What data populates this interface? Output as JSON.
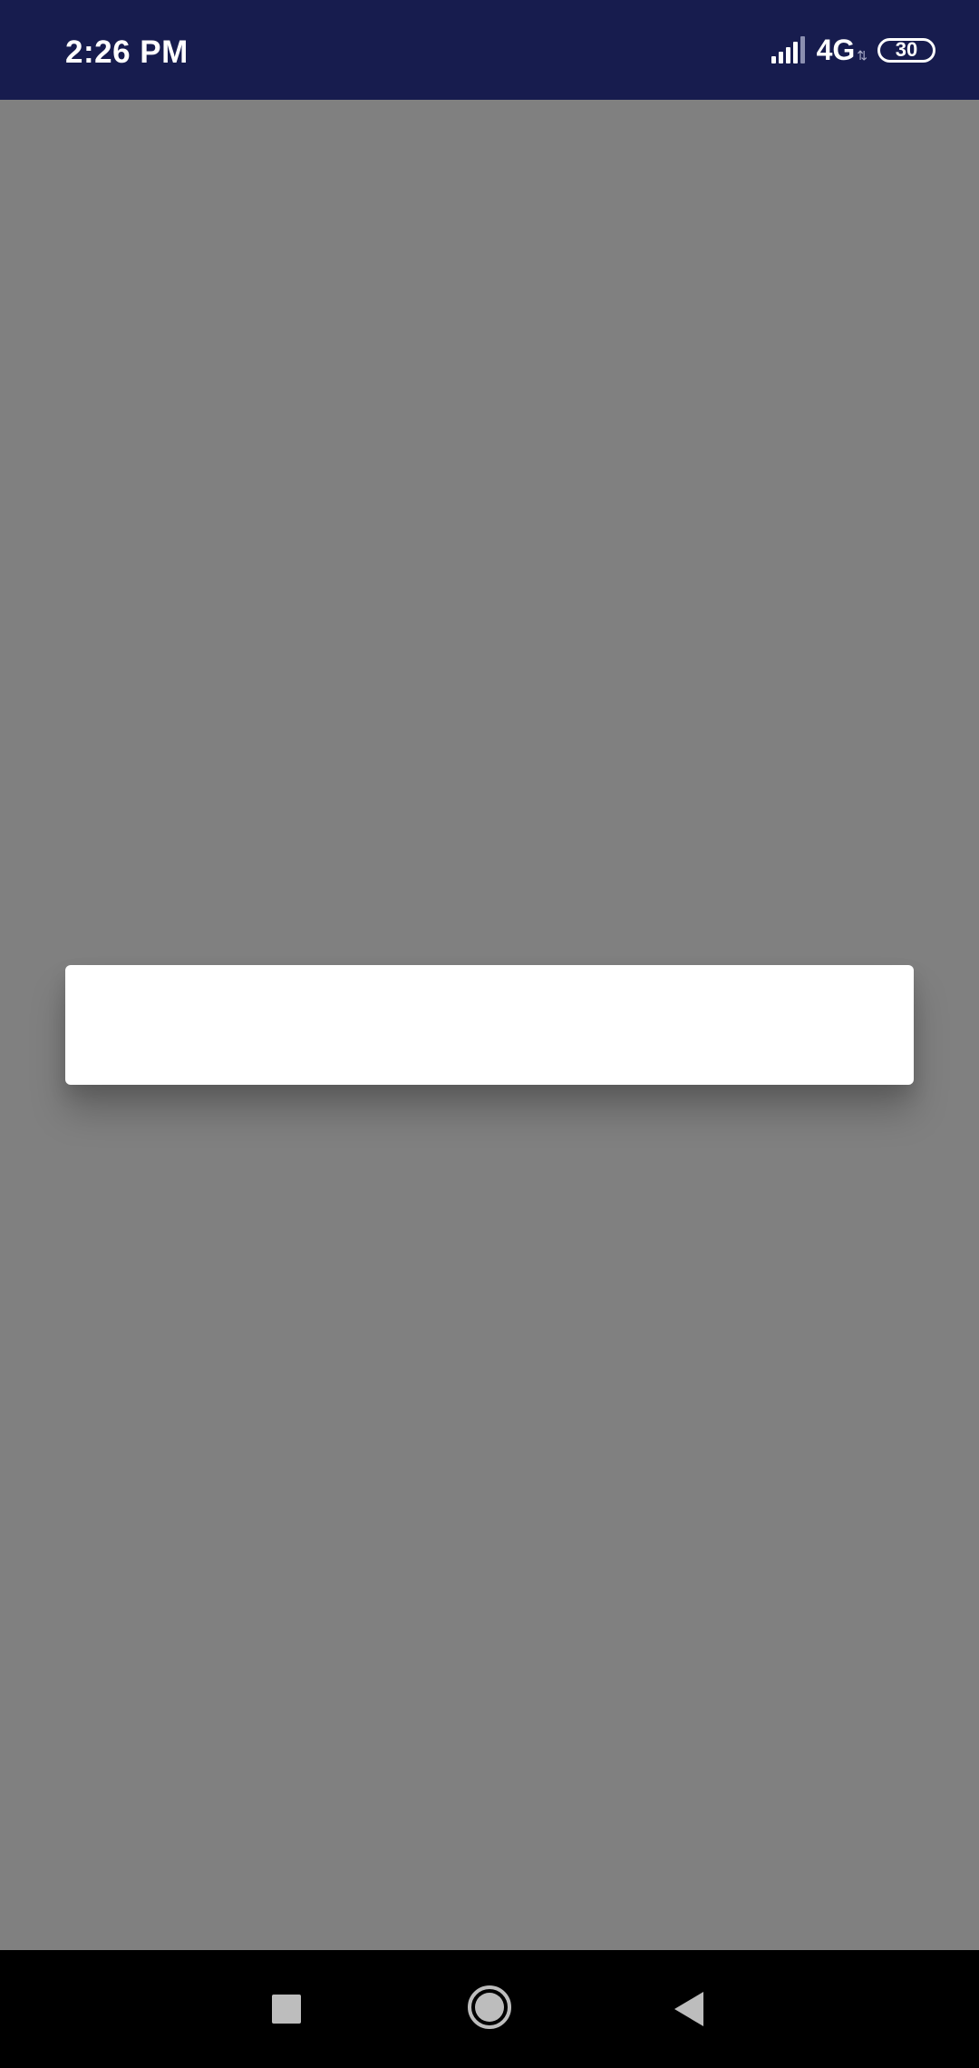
{
  "status_bar": {
    "time": "2:26 PM",
    "network": "4G",
    "data_activity": "⇅",
    "battery": "30",
    "background_color": "#171c4e"
  },
  "screen": {
    "scrim_color": "#808080"
  },
  "dialog": {
    "background_color": "#ffffff"
  },
  "nav_bar": {
    "icons": [
      "recents-square-icon",
      "home-circle-icon",
      "back-triangle-icon"
    ],
    "background_color": "#000000"
  }
}
